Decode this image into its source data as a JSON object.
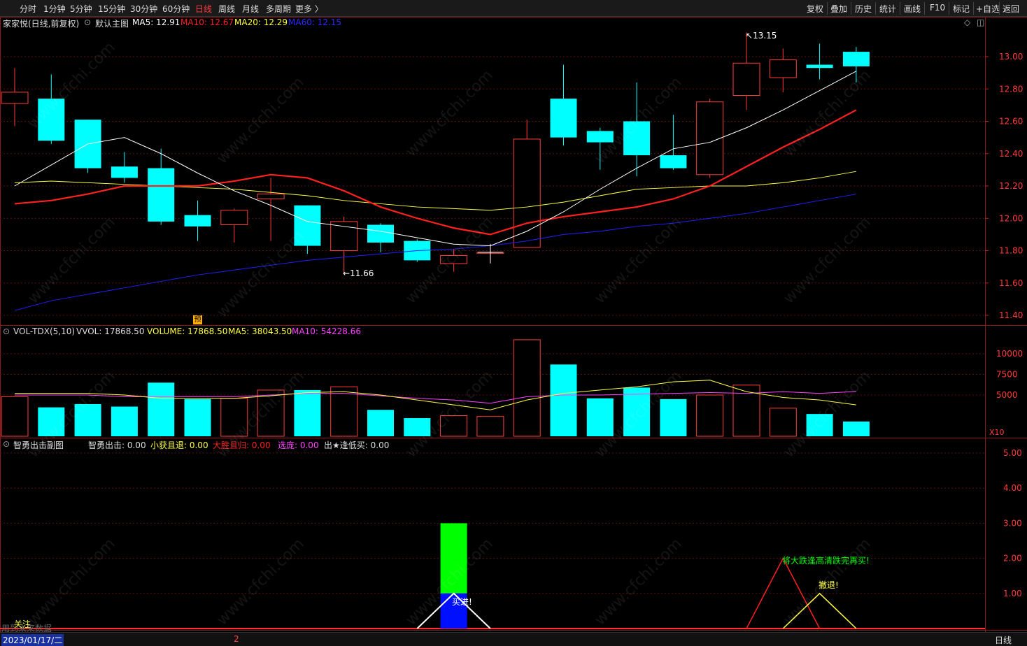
{
  "toolbar": {
    "periods": [
      "分时",
      "1分钟",
      "5分钟",
      "15分钟",
      "30分钟",
      "60分钟",
      "日线",
      "周线",
      "月线",
      "多周期",
      "更多 〉"
    ],
    "active_period": "日线",
    "right_tools": [
      "复权",
      "叠加",
      "历史",
      "统计",
      "画线",
      "F10",
      "标记",
      "+自选",
      "返回"
    ]
  },
  "main_panel": {
    "stock_title": "家家悦(日线,前复权)",
    "template_label": "默认主图",
    "ma5": "MA5: 12.91",
    "ma10": "MA10: 12.67",
    "ma20": "MA20: 12.29",
    "ma60": "MA60: 12.15",
    "high_marker": "13.15",
    "low_marker": "11.66",
    "badge": "预",
    "y_ticks": [
      "13.00",
      "12.80",
      "12.60",
      "12.40",
      "12.20",
      "12.00",
      "11.80",
      "11.60",
      "11.40"
    ]
  },
  "volume_panel": {
    "title": "VOL-TDX(5,10)",
    "vvol": "VVOL: 17868.50",
    "volume": "VOLUME: 17868.50",
    "ma5": "MA5: 38043.50",
    "ma10": "MA10: 54228.66",
    "y_ticks": [
      "10000",
      "7500",
      "5000"
    ],
    "unit": "X10"
  },
  "sub_panel": {
    "title": "智勇出击副图",
    "v1": "智勇出击: 0.00",
    "v2": "小获且退: 0.00",
    "v3": "大胜且归: 0.00",
    "v4": "选庞: 0.00",
    "v5": "出★逢低买: 0.00",
    "y_ticks": [
      "5.00",
      "4.00",
      "3.00",
      "2.00",
      "1.00"
    ],
    "label_buy": "买进!",
    "label_green": "将大跌逢高清跌完再买!",
    "label_retreat": "撤退!",
    "label_follow": "关注",
    "label_data": "用到未来数据"
  },
  "status": {
    "date": "2023/01/17/二",
    "page": "2",
    "period": "日线"
  },
  "watermark": "www.cfchi.com",
  "colors": {
    "up": "#ff3b3b",
    "down": "#00ffff",
    "ma5": "#ffffff",
    "ma10": "#ff2020",
    "ma20": "#ffff40",
    "ma60": "#2020ff",
    "vol_ma5": "#ffff40",
    "vol_ma10": "#ff40ff",
    "buy_green": "#00ff00",
    "buy_blue": "#0010ff"
  },
  "chart_data": [
    {
      "type": "candlestick",
      "title": "家家悦(日线,前复权)",
      "ylim": [
        11.35,
        13.28
      ],
      "series": [
        {
          "name": "K",
          "candles": [
            {
              "o": 12.71,
              "h": 12.93,
              "l": 12.57,
              "c": 12.78
            },
            {
              "o": 12.74,
              "h": 12.89,
              "l": 12.46,
              "c": 12.48
            },
            {
              "o": 12.61,
              "h": 12.61,
              "l": 12.28,
              "c": 12.31
            },
            {
              "o": 12.32,
              "h": 12.41,
              "l": 12.22,
              "c": 12.25
            },
            {
              "o": 12.31,
              "h": 12.43,
              "l": 11.96,
              "c": 11.98
            },
            {
              "o": 12.02,
              "h": 12.11,
              "l": 11.86,
              "c": 11.95
            },
            {
              "o": 11.96,
              "h": 12.06,
              "l": 11.85,
              "c": 12.05
            },
            {
              "o": 12.12,
              "h": 12.25,
              "l": 11.86,
              "c": 12.15
            },
            {
              "o": 12.08,
              "h": 12.08,
              "l": 11.78,
              "c": 11.83
            },
            {
              "o": 11.8,
              "h": 12.01,
              "l": 11.66,
              "c": 11.98
            },
            {
              "o": 11.96,
              "h": 11.97,
              "l": 11.79,
              "c": 11.85
            },
            {
              "o": 11.86,
              "h": 11.87,
              "l": 11.73,
              "c": 11.74
            },
            {
              "o": 11.72,
              "h": 11.81,
              "l": 11.67,
              "c": 11.77
            },
            {
              "o": 11.79,
              "h": 11.82,
              "l": 11.73,
              "c": 11.79
            },
            {
              "o": 11.82,
              "h": 12.61,
              "l": 11.82,
              "c": 12.49
            },
            {
              "o": 12.74,
              "h": 12.95,
              "l": 12.45,
              "c": 12.5
            },
            {
              "o": 12.54,
              "h": 12.56,
              "l": 12.3,
              "c": 12.47
            },
            {
              "o": 12.6,
              "h": 12.84,
              "l": 12.26,
              "c": 12.39
            },
            {
              "o": 12.39,
              "h": 12.64,
              "l": 12.3,
              "c": 12.31
            },
            {
              "o": 12.27,
              "h": 12.74,
              "l": 12.25,
              "c": 12.72
            },
            {
              "o": 12.76,
              "h": 13.15,
              "l": 12.67,
              "c": 12.96
            },
            {
              "o": 12.87,
              "h": 13.05,
              "l": 12.78,
              "c": 12.98
            },
            {
              "o": 12.95,
              "h": 13.08,
              "l": 12.86,
              "c": 12.93
            },
            {
              "o": 13.03,
              "h": 13.06,
              "l": 12.84,
              "c": 12.94
            }
          ]
        }
      ],
      "ma5": [
        12.2,
        12.33,
        12.46,
        12.5,
        12.4,
        12.28,
        12.17,
        12.08,
        11.98,
        11.95,
        11.92,
        11.88,
        11.84,
        11.83,
        11.92,
        12.04,
        12.18,
        12.31,
        12.43,
        12.47,
        12.56,
        12.67,
        12.79,
        12.91
      ],
      "ma10": [
        12.09,
        12.11,
        12.15,
        12.2,
        12.2,
        12.2,
        12.23,
        12.27,
        12.25,
        12.17,
        12.07,
        12.0,
        11.94,
        11.9,
        11.97,
        12.01,
        12.04,
        12.07,
        12.12,
        12.2,
        12.32,
        12.44,
        12.55,
        12.67
      ],
      "ma20": [
        12.22,
        12.23,
        12.22,
        12.21,
        12.2,
        12.19,
        12.18,
        12.16,
        12.14,
        12.11,
        12.09,
        12.07,
        12.06,
        12.05,
        12.07,
        12.1,
        12.14,
        12.18,
        12.19,
        12.2,
        12.2,
        12.22,
        12.25,
        12.29
      ],
      "ma60": [
        11.43,
        11.49,
        11.53,
        11.57,
        11.61,
        11.65,
        11.68,
        11.71,
        11.74,
        11.76,
        11.78,
        11.8,
        11.81,
        11.83,
        11.86,
        11.9,
        11.92,
        11.95,
        11.97,
        12.0,
        12.03,
        12.07,
        12.11,
        12.15
      ]
    },
    {
      "type": "bar",
      "title": "VOL-TDX(5,10)",
      "ylim": [
        0,
        12000
      ],
      "values": [
        4800,
        3500,
        3900,
        3600,
        6500,
        4500,
        4600,
        5600,
        5600,
        6000,
        3200,
        2200,
        2500,
        2400,
        11700,
        8700,
        4600,
        5900,
        4500,
        5000,
        6200,
        3400,
        2700,
        1787
      ],
      "ma5": [
        5200,
        5200,
        5200,
        5000,
        4600,
        4600,
        4600,
        4900,
        5300,
        5400,
        5000,
        4400,
        3800,
        3200,
        4400,
        5200,
        5600,
        6000,
        6600,
        6800,
        5400,
        4700,
        4400,
        3804
      ],
      "ma10": [
        5000,
        5000,
        5000,
        4800,
        4800,
        4800,
        4800,
        5000,
        5200,
        5200,
        4900,
        4600,
        4400,
        4000,
        4800,
        5000,
        5000,
        5100,
        5200,
        5300,
        5200,
        5400,
        5200,
        5423
      ]
    }
  ]
}
